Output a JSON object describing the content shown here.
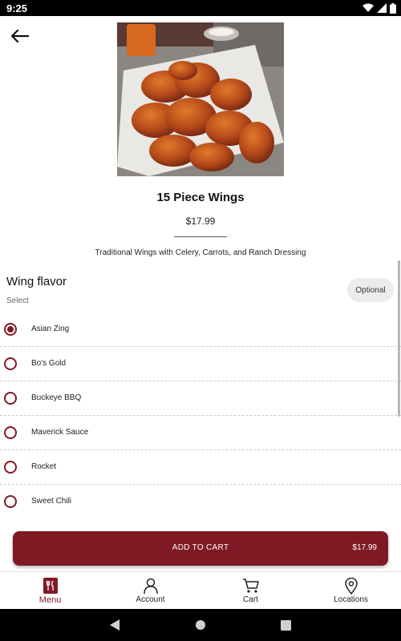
{
  "status_bar": {
    "time": "9:25"
  },
  "item": {
    "title": "15 Piece Wings",
    "price": "$17.99",
    "description": "Traditional Wings with Celery, Carrots, and Ranch Dressing"
  },
  "section": {
    "title": "Wing flavor",
    "subtitle": "Select",
    "badge": "Optional"
  },
  "options": [
    {
      "label": "Asian Zing",
      "selected": true
    },
    {
      "label": "Bo's Gold",
      "selected": false
    },
    {
      "label": "Buckeye BBQ",
      "selected": false
    },
    {
      "label": "Maverick Sauce",
      "selected": false
    },
    {
      "label": "Rocket",
      "selected": false
    },
    {
      "label": "Sweet Chili",
      "selected": false
    }
  ],
  "cart": {
    "label": "ADD TO CART",
    "price": "$17.99"
  },
  "nav": [
    {
      "label": "Menu",
      "icon": "menu-utensils-icon",
      "active": true
    },
    {
      "label": "Account",
      "icon": "account-icon",
      "active": false
    },
    {
      "label": "Cart",
      "icon": "cart-icon",
      "active": false
    },
    {
      "label": "Locations",
      "icon": "location-pin-icon",
      "active": false
    }
  ],
  "colors": {
    "brand": "#7f1a24",
    "badge_bg": "#ececec"
  }
}
